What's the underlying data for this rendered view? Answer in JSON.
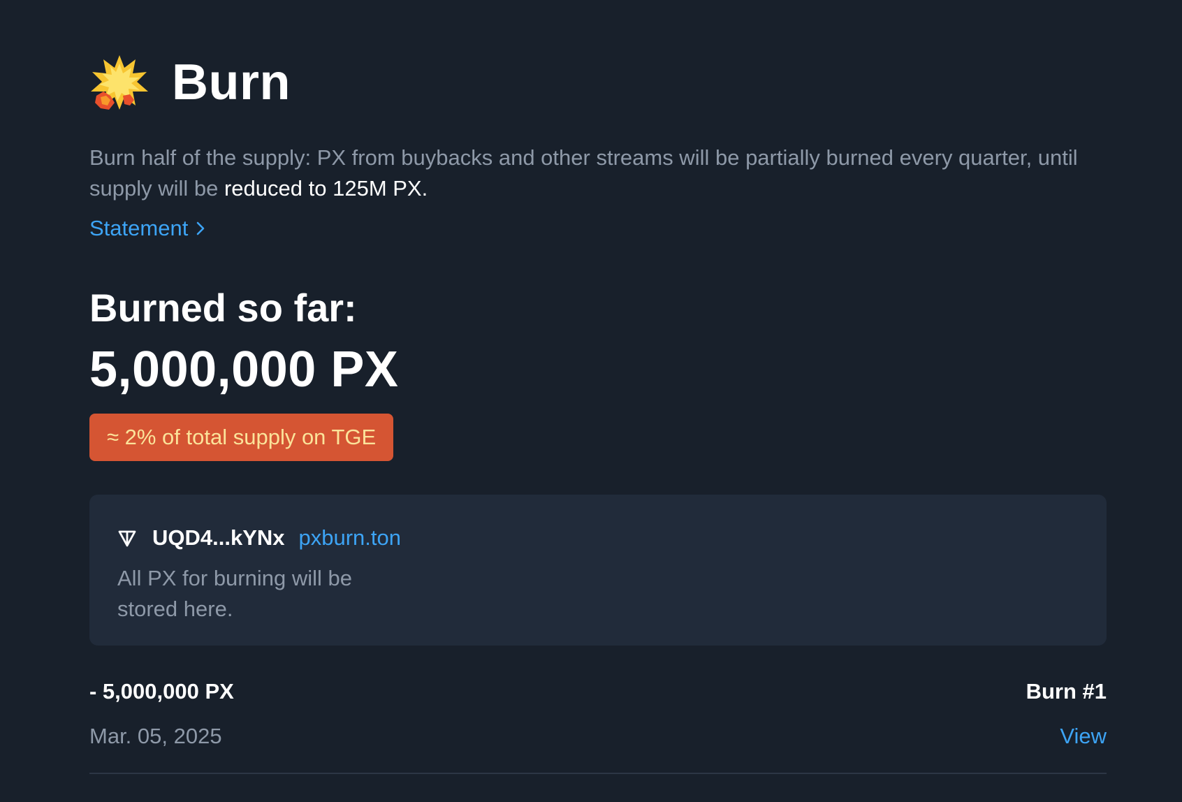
{
  "header": {
    "icon": "collision-burst-icon",
    "title": "Burn"
  },
  "description": {
    "text": "Burn half of the supply: PX from buybacks and other streams will be partially burned every quarter, until supply will be ",
    "highlight": "reduced to 125M PX."
  },
  "statement": {
    "label": "Statement",
    "icon": "chevron-right-icon"
  },
  "burned": {
    "label": "Burned so far:",
    "amount": "5,000,000 PX",
    "badge": "≈ 2% of total supply on TGE"
  },
  "wallet": {
    "icon": "ton-icon",
    "address": "UQD4...kYNx",
    "domain": "pxburn.ton",
    "note": "All PX for burning will be stored here."
  },
  "history": [
    {
      "amount": "- 5,000,000 PX",
      "label": "Burn #1",
      "date": "Mar. 05, 2025",
      "action": "View"
    }
  ],
  "colors": {
    "background": "#18202b",
    "card": "#212b3a",
    "link": "#3da4f5",
    "muted_text": "#8e99a8",
    "badge_bg": "#d55533",
    "badge_text": "#fbe39a"
  }
}
